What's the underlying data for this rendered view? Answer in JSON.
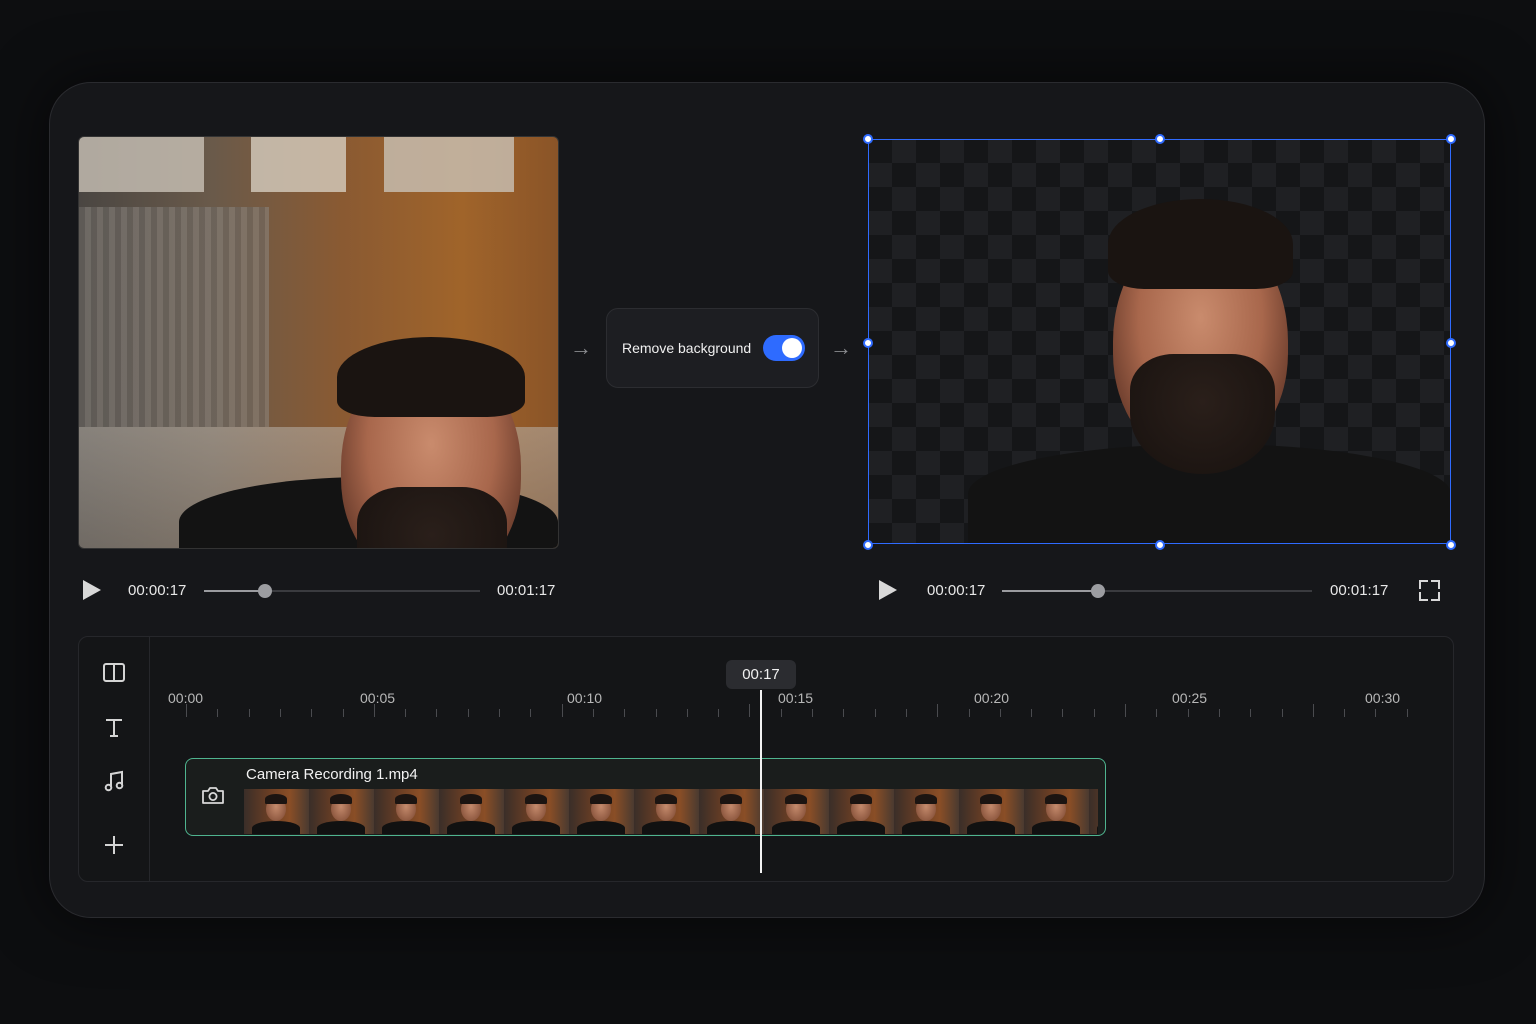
{
  "toggle": {
    "label": "Remove background",
    "enabled": true
  },
  "source_player": {
    "current_time": "00:00:17",
    "duration": "00:01:17",
    "progress": 0.22
  },
  "output_player": {
    "current_time": "00:00:17",
    "duration": "00:01:17",
    "progress": 0.31
  },
  "timeline": {
    "playhead_label": "00:17",
    "ruler": [
      "00:00",
      "00:05",
      "00:10",
      "00:15",
      "00:20",
      "00:25",
      "00:30"
    ],
    "clip": {
      "name": "Camera Recording 1.mp4"
    },
    "tools": [
      "layout-icon",
      "text-icon",
      "music-icon",
      "add-icon"
    ]
  },
  "colors": {
    "accent": "#2f6bff",
    "clip_border": "#4fb48f"
  }
}
